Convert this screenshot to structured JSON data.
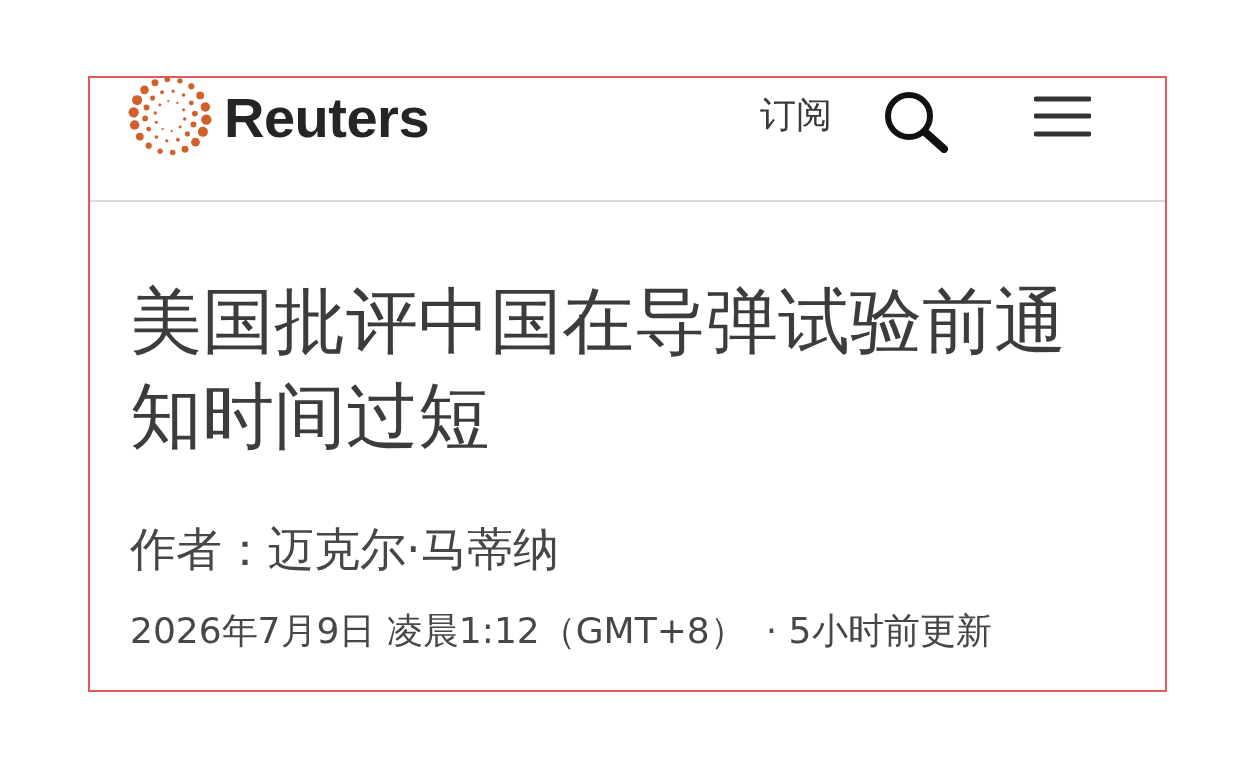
{
  "header": {
    "logo": {
      "wordmark": "Reuters"
    },
    "subscribe": "订阅"
  },
  "article": {
    "headline": "美国批评中国在导弹试验前通知时间过短",
    "byline": "作者：迈克尔·马蒂纳",
    "published": "2026年7月9日 凌晨1:12（GMT+8）",
    "updated": "· 5小时前更新"
  }
}
